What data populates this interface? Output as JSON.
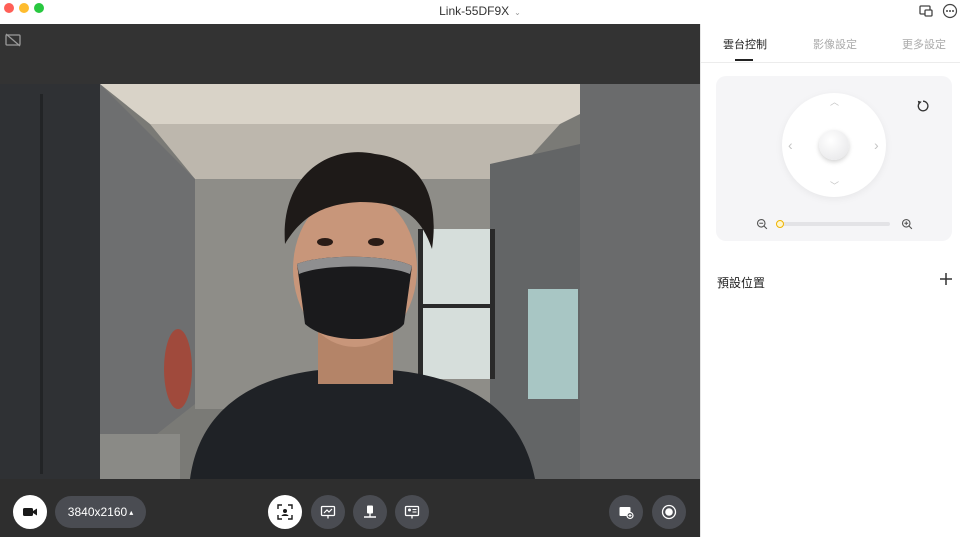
{
  "window": {
    "title": "Link-55DF9X",
    "title_caret": "⌄"
  },
  "toolbar": {
    "resolution": "3840x2160",
    "resolution_caret": "▴"
  },
  "panel": {
    "tabs": [
      {
        "label": "雲台控制",
        "active": true
      },
      {
        "label": "影像設定",
        "active": false
      },
      {
        "label": "更多設定",
        "active": false
      }
    ],
    "ptz": {
      "arrows": {
        "up": "︿",
        "down": "﹀",
        "left": "‹",
        "right": "›"
      },
      "zoom_level": 0.0
    },
    "presets_label": "預設位置"
  },
  "colors": {
    "accent": "#f0b400",
    "video_bar": "#2e2e2e",
    "button_bg": "#4a4c52",
    "panel_card": "#f5f5f7"
  },
  "icons": [
    "no-signal-icon",
    "camera-icon",
    "auto-frame-icon",
    "whiteboard-icon",
    "desk-view-icon",
    "presenter-icon",
    "snapshot-icon",
    "record-icon",
    "reset-icon",
    "zoom-out-icon",
    "zoom-in-icon",
    "plus-icon",
    "window-icon",
    "more-icon"
  ]
}
